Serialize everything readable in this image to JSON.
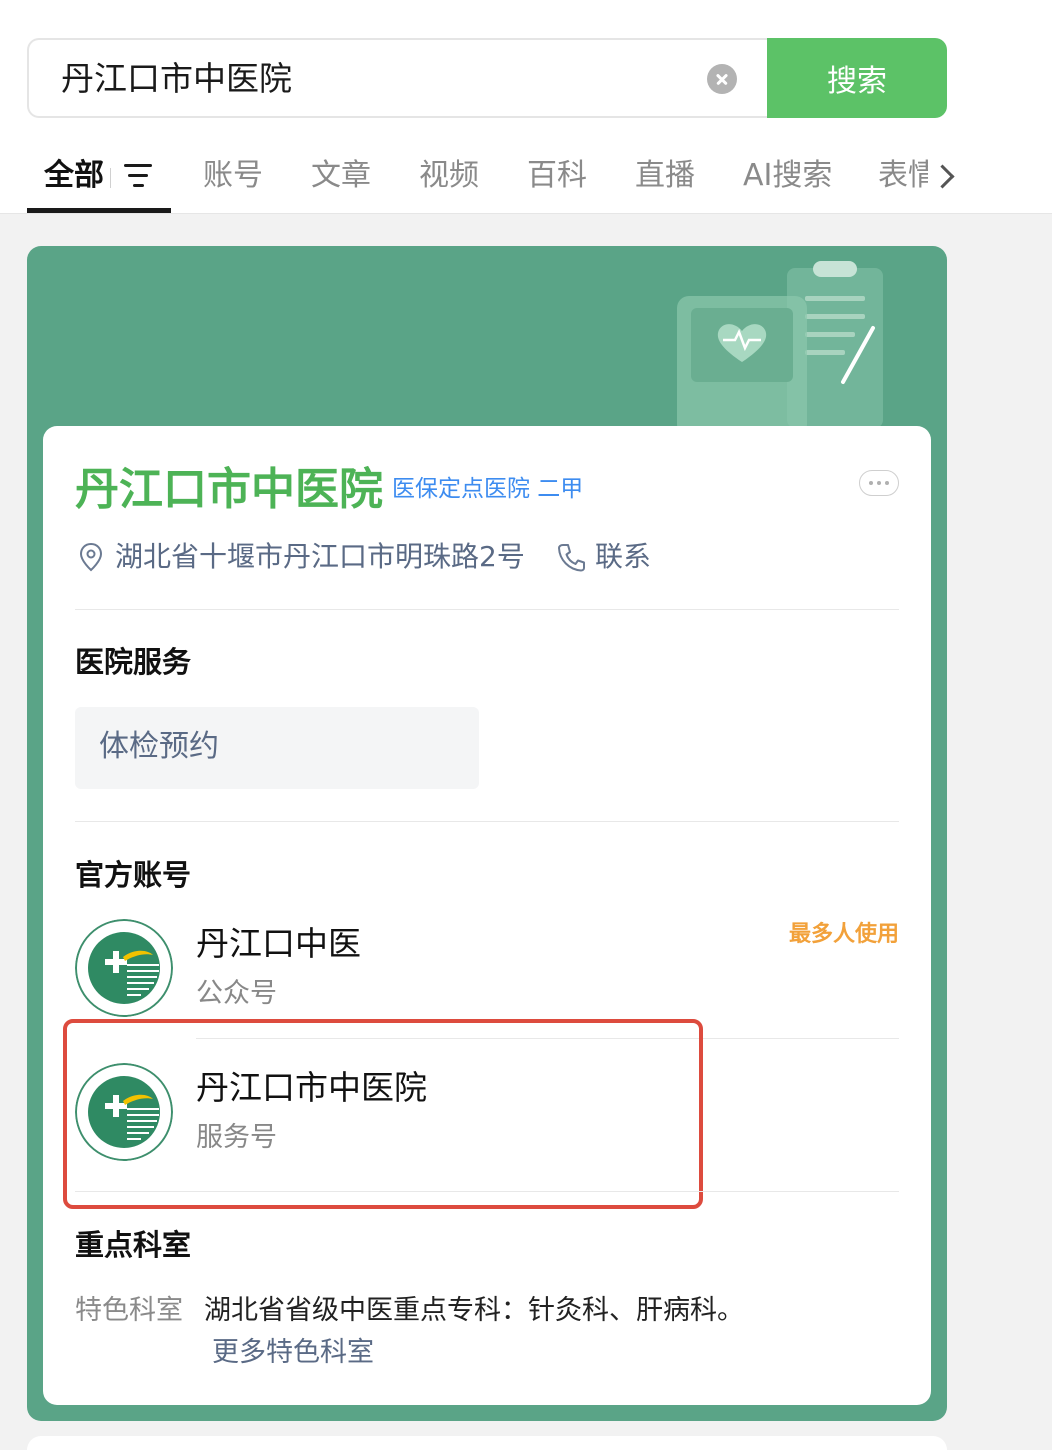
{
  "search": {
    "query": "丹江口市中医院",
    "button_label": "搜索"
  },
  "tabs": [
    "全部",
    "账号",
    "文章",
    "视频",
    "百科",
    "直播",
    "AI搜索",
    "表情"
  ],
  "hospital": {
    "name": "丹江口市中医院",
    "tags": "医保定点医院 二甲",
    "address": "湖北省十堰市丹江口市明珠路2号",
    "contact_label": "联系"
  },
  "services": {
    "title": "医院服务",
    "items": [
      "体检预约"
    ]
  },
  "accounts": {
    "title": "官方账号",
    "items": [
      {
        "name": "丹江口中医",
        "type": "公众号",
        "badge": "最多人使用"
      },
      {
        "name": "丹江口市中医院",
        "type": "服务号",
        "badge": ""
      }
    ]
  },
  "departments": {
    "title": "重点科室",
    "label": "特色科室",
    "text": "湖北省省级中医重点专科：针灸科、肝病科。",
    "more_link": "更多特色科室"
  },
  "colors": {
    "accent_green": "#5cc267",
    "card_green": "#5aa487",
    "name_green": "#4db356",
    "tag_blue": "#3d8cf0",
    "badge_orange": "#f2a13a",
    "highlight_red": "#dd4b3e"
  }
}
